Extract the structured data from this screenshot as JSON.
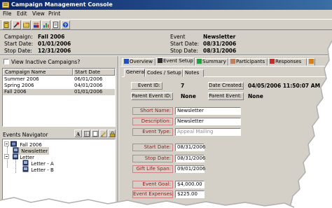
{
  "window": {
    "title": "Campaign Management Console"
  },
  "menu": [
    "File",
    "Edit",
    "View",
    "Print"
  ],
  "toolbar": {
    "icons": [
      "book-icon",
      "tools-icon",
      "folder-icon",
      "users-icon",
      "chart-icon",
      "document-icon",
      "help-icon"
    ]
  },
  "header": {
    "campaign_label": "Campaign:",
    "campaign_value": "Fall 2006",
    "start_label": "Start Date:",
    "start_value": "01/01/2006",
    "stop_label": "Stop Date:",
    "stop_value": "12/31/2006",
    "event_label": "Event",
    "event_value": "Newsletter",
    "event_start_label": "Start Date:",
    "event_start_value": "08/31/2006",
    "event_stop_label": "Stop Date:",
    "event_stop_value": "08/31/2006"
  },
  "left": {
    "view_inactive_label": "View Inactive Campaigns?",
    "columns": [
      "Campaign Name",
      "Start Date"
    ],
    "rows": [
      [
        "Summer 2006",
        "06/01/2006"
      ],
      [
        "Spring 2006",
        "04/01/2006"
      ],
      [
        "Fall 2006",
        "01/01/2006"
      ]
    ],
    "selected_row": 2
  },
  "navigator": {
    "title": "Events Navigator",
    "tree": [
      {
        "label": "Fall 2006",
        "level": 0,
        "icon": "campaign-icon"
      },
      {
        "label": "Newsletter",
        "level": 1,
        "icon": "newsletter-icon"
      },
      {
        "label": "Letter",
        "level": 1,
        "icon": "letter-icon"
      },
      {
        "label": "Letter - A",
        "level": 2,
        "icon": "letter-icon"
      },
      {
        "label": "Letter - B",
        "level": 2,
        "icon": "letter-icon"
      }
    ]
  },
  "tabs": {
    "main": [
      "Overview",
      "Event Setup",
      "Summary",
      "Participants",
      "Responses"
    ],
    "active_main": 1,
    "sub": [
      "General",
      "Codes / Setup",
      "Notes"
    ],
    "active_sub": 0
  },
  "form": {
    "event_id_label": "Event ID:",
    "event_id_value": "7",
    "date_created_label": "Date Created:",
    "date_created_value": "04/05/2006 11:50:07 AM",
    "parent_event_id_label": "Parent Event ID:",
    "parent_event_id_value": "None",
    "parent_event_label": "Parent Event:",
    "parent_event_value": "None",
    "short_name_label": "Short Name:",
    "short_name_value": "Newsletter",
    "description_label": "Description:",
    "description_value": "Newsletter",
    "event_type_label": "Event Type:",
    "event_type_value": "Appeal Mailing",
    "start_date_label": "Start Date:",
    "start_date_value": "08/31/2006",
    "stop_date_label": "Stop Date:",
    "stop_date_value": "08/31/2006",
    "gift_life_label": "Gift Life Span:",
    "gift_life_value": "09/01/2006",
    "event_goal_label": "Event Goal:",
    "event_goal_value": "$4,000.00",
    "event_expenses_label": "Event Expenses:",
    "event_expenses_value": "$225.00"
  }
}
